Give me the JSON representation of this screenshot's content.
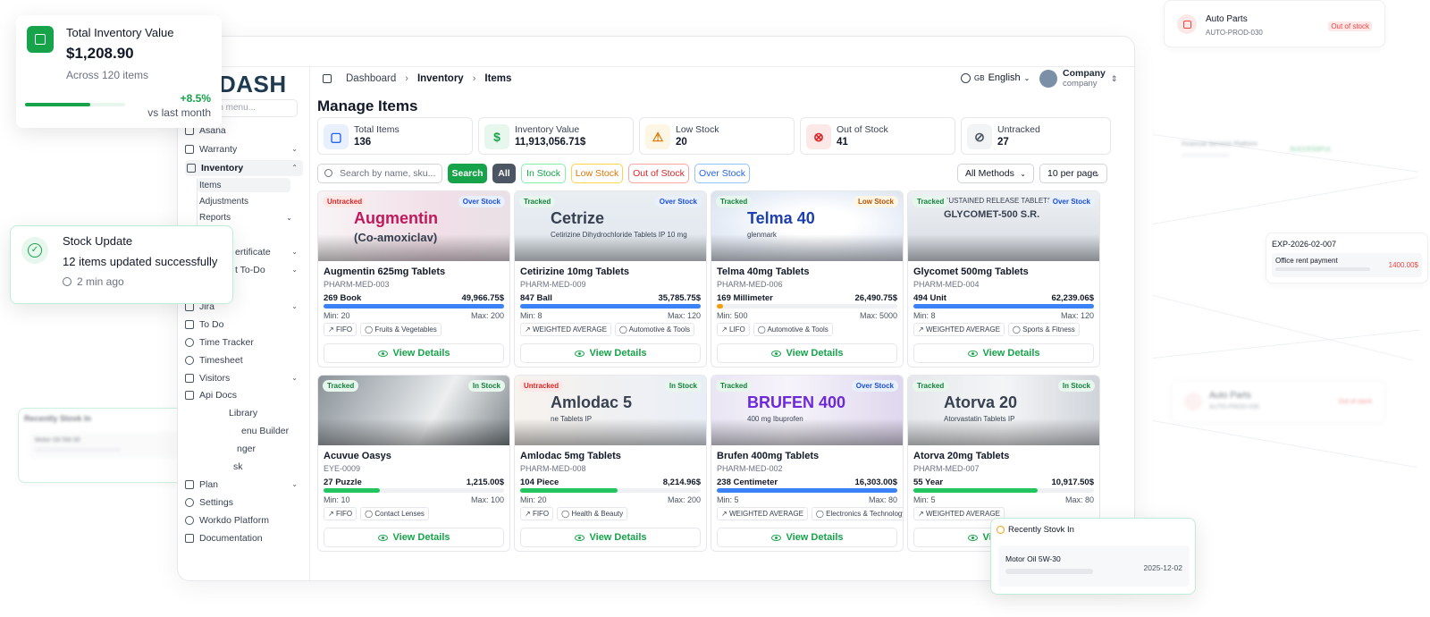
{
  "background": {
    "auto_parts_top": {
      "name": "Auto Parts",
      "code": "AUTO-PROD-030",
      "status": "Out of stock"
    },
    "auto_parts_blur": {
      "name": "Auto Parts",
      "code": "AUTO-PROD-030",
      "status": "Out of stock"
    },
    "expense": {
      "ref": "EXP-2026-02-007",
      "desc": "Office rent payment",
      "amount": "1400.00$"
    },
    "faint_label": "Financial Services Platform",
    "faint_badge": "SUCCESSFUL",
    "recent_left": {
      "title": "Recently Stovk In",
      "item": "Motor Oil 5W-30",
      "date": "2025-12-02"
    }
  },
  "float_total": {
    "title": "Total Inventory Value",
    "value": "$1,208.90",
    "sub": "Across 120 items",
    "change": "+8.5%",
    "change_label": "vs last month",
    "progress": 0.65
  },
  "float_stock": {
    "title": "Stock Update",
    "message": "12 items updated successfully",
    "time": "2 min ago"
  },
  "float_recent": {
    "title": "Recently Stovk In",
    "item": "Motor Oil 5W-30",
    "date": "2025-12-02"
  },
  "sidebar": {
    "logo": "DASH",
    "search_placeholder": "rch menu...",
    "items": [
      {
        "label": "Asana"
      },
      {
        "label": "Warranty"
      },
      {
        "label": "Inventory"
      },
      {
        "label": "ertificate"
      },
      {
        "label": "t To-Do"
      },
      {
        "label": "Jira"
      },
      {
        "label": "To Do"
      },
      {
        "label": "Time Tracker"
      },
      {
        "label": "Timesheet"
      },
      {
        "label": "Visitors"
      },
      {
        "label": "Api Docs"
      },
      {
        "label": "Library"
      },
      {
        "label": "enu Builder"
      },
      {
        "label": "nger"
      },
      {
        "label": "sk"
      },
      {
        "label": "Plan"
      },
      {
        "label": "Settings"
      },
      {
        "label": "Workdo Platform"
      },
      {
        "label": "Documentation"
      }
    ],
    "subitems": [
      "Items",
      "Adjustments",
      "Reports"
    ]
  },
  "header": {
    "breadcrumb": [
      "Dashboard",
      "Inventory",
      "Items"
    ],
    "lang_code": "GB",
    "lang": "English",
    "company_name": "Company",
    "company_sub": "company"
  },
  "page_title": "Manage Items",
  "stats": [
    {
      "label": "Total Items",
      "value": "136"
    },
    {
      "label": "Inventory Value",
      "value": "11,913,056.71$"
    },
    {
      "label": "Low Stock",
      "value": "20"
    },
    {
      "label": "Out of Stock",
      "value": "41"
    },
    {
      "label": "Untracked",
      "value": "27"
    }
  ],
  "toolbar": {
    "search_placeholder": "Search by name, sku...",
    "search_btn": "Search",
    "filters": [
      "All",
      "In Stock",
      "Low Stock",
      "Out of Stock",
      "Over Stock"
    ],
    "method": "All Methods",
    "per_page": "10 per page"
  },
  "view_details": "View Details",
  "items": [
    {
      "track": "Untracked",
      "status": "Over Stock",
      "name": "Augmentin 625mg Tablets",
      "sku": "PHARM-MED-003",
      "qty": "269 Book",
      "amount": "49,966.75$",
      "min": "Min: 20",
      "max": "Max: 200",
      "fill": 1.0,
      "bar_color": "#3b82f6",
      "method": "FIFO",
      "category": "Fruits & Vegetables",
      "img_text": "Augmentin",
      "img_sub": "(Co-amoxiclav)"
    },
    {
      "track": "Tracked",
      "status": "Over Stock",
      "name": "Cetirizine 10mg Tablets",
      "sku": "PHARM-MED-009",
      "qty": "847 Ball",
      "amount": "35,785.75$",
      "min": "Min: 8",
      "max": "Max: 120",
      "fill": 1.0,
      "bar_color": "#3b82f6",
      "method": "WEIGHTED AVERAGE",
      "category": "Automotive & Tools",
      "img_text": "Cetrize",
      "img_sub": "Cetirizine Dihydrochloride Tablets IP 10 mg"
    },
    {
      "track": "Tracked",
      "status": "Low Stock",
      "name": "Telma 40mg Tablets",
      "sku": "PHARM-MED-006",
      "qty": "169 Millimeter",
      "amount": "26,490.75$",
      "min": "Min: 500",
      "max": "Max: 5000",
      "fill": 0.034,
      "bar_color": "#f59e0b",
      "method": "LIFO",
      "category": "Automotive & Tools",
      "img_text": "Telma 40",
      "img_sub": "glenmark"
    },
    {
      "track": "Tracked",
      "status": "Over Stock",
      "name": "Glycomet 500mg Tablets",
      "sku": "PHARM-MED-004",
      "qty": "494 Unit",
      "amount": "62,239.06$",
      "min": "Min: 8",
      "max": "Max: 120",
      "fill": 1.0,
      "bar_color": "#3b82f6",
      "method": "WEIGHTED AVERAGE",
      "category": "Sports & Fitness",
      "img_text": "GLYCOMET-500 S.R.",
      "img_sub": "SUSTAINED RELEASE TABLETS"
    },
    {
      "track": "Tracked",
      "status": "In Stock",
      "name": "Acuvue Oasys",
      "sku": "EYE-0009",
      "qty": "27 Puzzle",
      "amount": "1,215.00$",
      "min": "Min: 10",
      "max": "Max: 100",
      "fill": 0.31,
      "bar_color": "#22c55e",
      "method": "FIFO",
      "category": "Contact Lenses",
      "img_text": "",
      "img_sub": ""
    },
    {
      "track": "Untracked",
      "status": "In Stock",
      "name": "Amlodac 5mg Tablets",
      "sku": "PHARM-MED-008",
      "qty": "104 Piece",
      "amount": "8,214.96$",
      "min": "Min: 20",
      "max": "Max: 200",
      "fill": 0.54,
      "bar_color": "#22c55e",
      "method": "FIFO",
      "category": "Health & Beauty",
      "img_text": "Amlodac 5",
      "img_sub": "ne Tablets IP"
    },
    {
      "track": "Tracked",
      "status": "Over Stock",
      "name": "Brufen 400mg Tablets",
      "sku": "PHARM-MED-002",
      "qty": "238 Centimeter",
      "amount": "16,303.00$",
      "min": "Min: 5",
      "max": "Max: 80",
      "fill": 1.0,
      "bar_color": "#3b82f6",
      "method": "WEIGHTED AVERAGE",
      "category": "Electronics & Technology",
      "img_text": "BRUFEN 400",
      "img_sub": "400 mg Ibuprofen"
    },
    {
      "track": "Tracked",
      "status": "In Stock",
      "name": "Atorva 20mg Tablets",
      "sku": "PHARM-MED-007",
      "qty": "55 Year",
      "amount": "10,917.50$",
      "min": "Min: 5",
      "max": "Max: 80",
      "fill": 0.69,
      "bar_color": "#22c55e",
      "method": "WEIGHTED AVERAGE",
      "category": "",
      "img_text": "Atorva 20",
      "img_sub": "Atorvastatin Tablets IP"
    }
  ],
  "colors": {
    "accent": "#16a34a",
    "over": "#2563eb",
    "low": "#d97706",
    "out": "#dc2626"
  }
}
